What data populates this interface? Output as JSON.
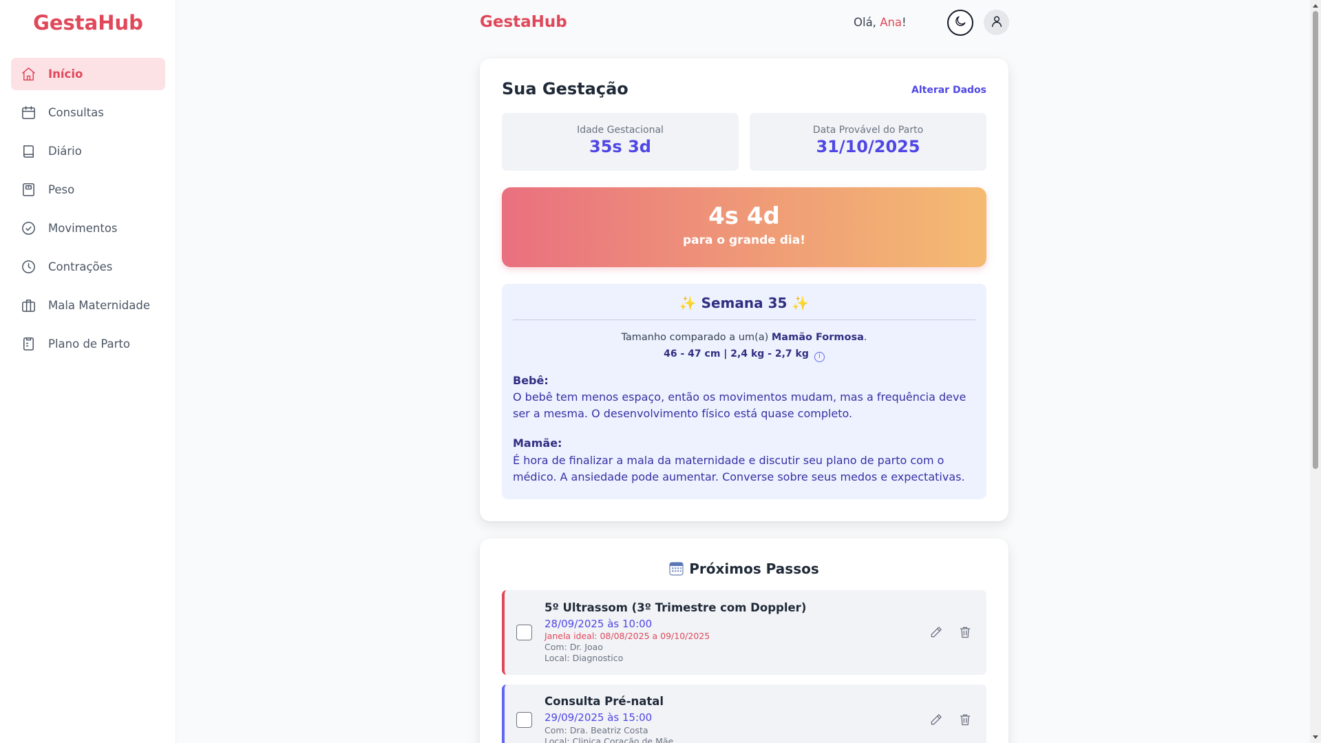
{
  "app": {
    "name": "GestaHub"
  },
  "sidebar": {
    "logo": "GestaHub",
    "items": [
      {
        "label": "Início",
        "icon": "home-icon",
        "active": true
      },
      {
        "label": "Consultas",
        "icon": "calendar-icon",
        "active": false
      },
      {
        "label": "Diário",
        "icon": "book-icon",
        "active": false
      },
      {
        "label": "Peso",
        "icon": "scale-icon",
        "active": false
      },
      {
        "label": "Movimentos",
        "icon": "check-circle-icon",
        "active": false
      },
      {
        "label": "Contrações",
        "icon": "clock-icon",
        "active": false
      },
      {
        "label": "Mala Maternidade",
        "icon": "briefcase-icon",
        "active": false
      },
      {
        "label": "Plano de Parto",
        "icon": "clipboard-icon",
        "active": false
      }
    ]
  },
  "header": {
    "logo": "GestaHub",
    "greeting_prefix": "Olá, ",
    "user_name": "Ana",
    "greeting_suffix": "!",
    "theme_icon": "moon-icon",
    "user_icon": "user-icon"
  },
  "pregnancy": {
    "title": "Sua Gestação",
    "edit_label": "Alterar Dados",
    "gestational_age_label": "Idade Gestacional",
    "gestational_age_value": "35s 3d",
    "due_date_label": "Data Provável do Parto",
    "due_date_value": "31/10/2025",
    "countdown_value": "4s 4d",
    "countdown_caption": "para o grande dia!"
  },
  "week": {
    "sparkle": "✨",
    "title": "Semana 35",
    "size_prefix": "Tamanho comparado a um(a) ",
    "size_fruit": "Mamão Formosa",
    "size_suffix": ".",
    "measurements": "46 - 47 cm | 2,4 kg - 2,7 kg",
    "info_icon": "info-icon",
    "baby_label": "Bebê:",
    "baby_text": "O bebê tem menos espaço, então os movimentos mudam, mas a frequência deve ser a mesma. O desenvolvimento físico está quase completo.",
    "mom_label": "Mamãe:",
    "mom_text": "É hora de finalizar a mala da maternidade e discutir seu plano de parto com o médico. A ansiedade pode aumentar. Converse sobre seus medos e expectativas."
  },
  "next_steps": {
    "title": "Próximos Passos",
    "title_icon": "calendar-emoji-icon",
    "items": [
      {
        "title": "5º Ultrassom (3º Trimestre com Doppler)",
        "datetime": "28/09/2025 às 10:00",
        "window": "Janela ideal: 08/08/2025 a 09/10/2025",
        "with": "Com: Dr. Joao",
        "location": "Local: Diagnostico",
        "accent": "#e0485a"
      },
      {
        "title": "Consulta Pré-natal",
        "datetime": "29/09/2025 às 15:00",
        "with": "Com: Dra. Beatriz Costa",
        "location": "Local: Clinica Coração de Mãe",
        "accent": "#6366f1"
      }
    ]
  },
  "colors": {
    "brand": "#e0485a",
    "accent": "#4f46e5",
    "sidebar_active_bg": "#fde2e5",
    "week_bg": "#eef2ff"
  }
}
